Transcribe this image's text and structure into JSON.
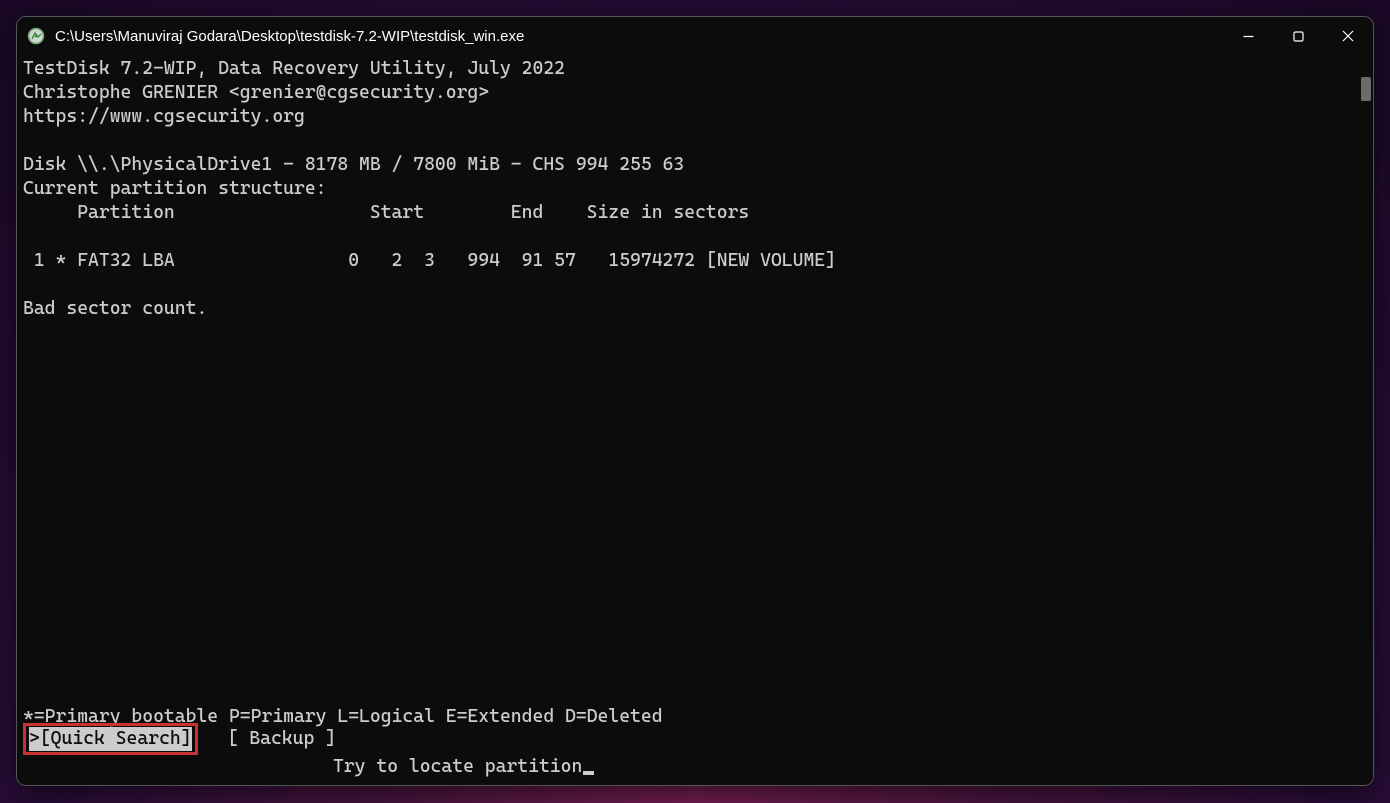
{
  "window": {
    "title": "C:\\Users\\Manuviraj Godara\\Desktop\\testdisk-7.2-WIP\\testdisk_win.exe"
  },
  "header": {
    "line1": "TestDisk 7.2-WIP, Data Recovery Utility, July 2022",
    "line2": "Christophe GRENIER <grenier@cgsecurity.org>",
    "line3": "https://www.cgsecurity.org"
  },
  "disk": {
    "info": "Disk \\\\.\\PhysicalDrive1 - 8178 MB / 7800 MiB - CHS 994 255 63",
    "structure_label": "Current partition structure:",
    "columns": "     Partition                  Start        End    Size in sectors"
  },
  "partitions": {
    "row1": " 1 * FAT32 LBA                0   2  3   994  91 57   15974272 [NEW VOLUME]"
  },
  "status": {
    "message": "Bad sector count."
  },
  "legend": {
    "text": "*=Primary bootable  P=Primary  L=Logical  E=Extended  D=Deleted"
  },
  "menu": {
    "selected": ">[Quick Search]",
    "backup": "[ Backup ]"
  },
  "hint": {
    "text": "Try to locate partition"
  }
}
